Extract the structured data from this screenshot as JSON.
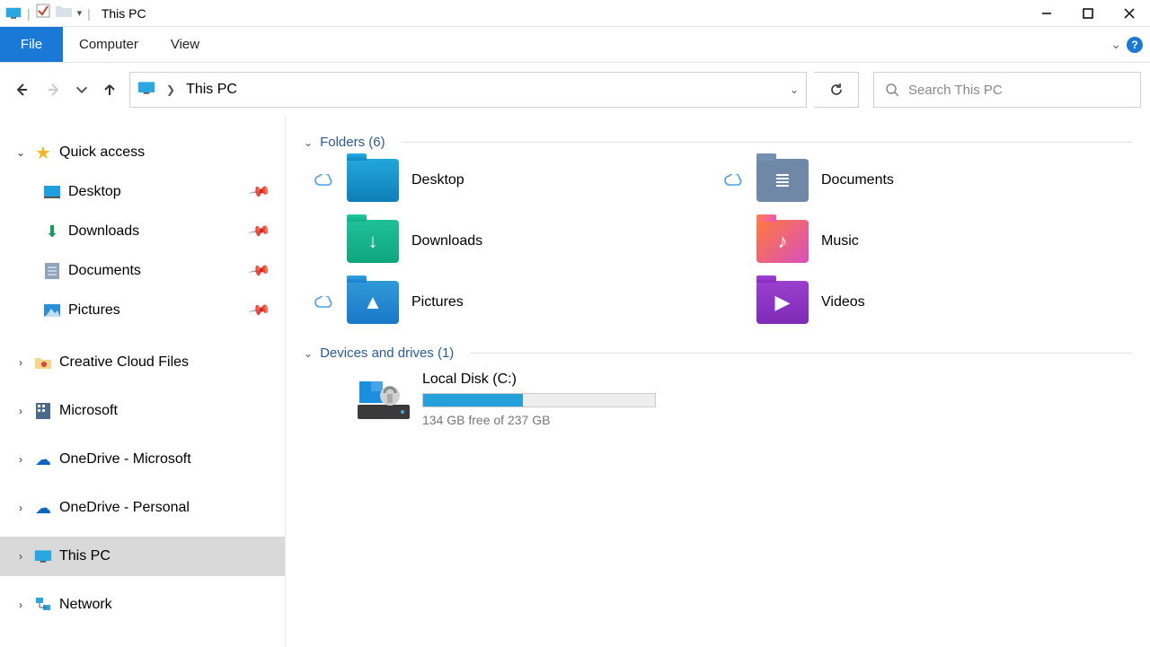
{
  "window": {
    "title": "This PC"
  },
  "ribbon": {
    "file": "File",
    "tabs": [
      "Computer",
      "View"
    ]
  },
  "address": {
    "location": "This PC"
  },
  "search": {
    "placeholder": "Search This PC"
  },
  "sidebar": {
    "quick_access": {
      "label": "Quick access"
    },
    "items": [
      {
        "label": "Desktop",
        "pinned": true
      },
      {
        "label": "Downloads",
        "pinned": true
      },
      {
        "label": "Documents",
        "pinned": true
      },
      {
        "label": "Pictures",
        "pinned": true
      }
    ],
    "below": [
      {
        "label": "Creative Cloud Files"
      },
      {
        "label": "Microsoft"
      },
      {
        "label": "OneDrive - Microsoft"
      },
      {
        "label": "OneDrive - Personal"
      },
      {
        "label": "This PC"
      },
      {
        "label": "Network"
      }
    ]
  },
  "sections": {
    "folders_header": "Folders (6)",
    "drives_header": "Devices and drives (1)"
  },
  "folders": [
    {
      "label": "Desktop",
      "class": "f-desktop",
      "cloud": true,
      "glyph": ""
    },
    {
      "label": "Documents",
      "class": "f-documents",
      "cloud": true,
      "glyph": "≣"
    },
    {
      "label": "Downloads",
      "class": "f-downloads",
      "cloud": false,
      "glyph": "↓"
    },
    {
      "label": "Music",
      "class": "f-music",
      "cloud": false,
      "glyph": "♪"
    },
    {
      "label": "Pictures",
      "class": "f-pictures",
      "cloud": true,
      "glyph": "▲"
    },
    {
      "label": "Videos",
      "class": "f-videos",
      "cloud": false,
      "glyph": "▶"
    }
  ],
  "drive": {
    "name": "Local Disk (C:)",
    "free_text": "134 GB free of 237 GB",
    "used_percent": 43
  }
}
